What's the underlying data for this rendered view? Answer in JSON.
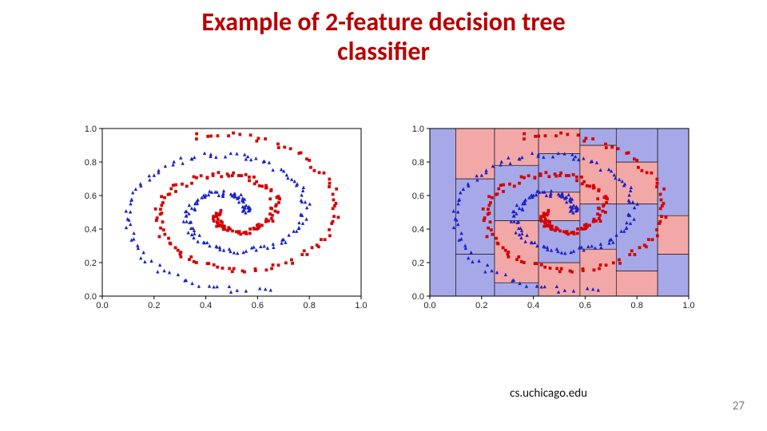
{
  "title_line1": "Example of 2-feature decision tree",
  "title_line2": "classifier",
  "attribution": "cs.uchicago.edu",
  "page_number": "27",
  "chart_data": [
    {
      "type": "scatter",
      "title": "",
      "xlabel": "",
      "ylabel": "",
      "xlim": [
        0.0,
        1.0
      ],
      "ylim": [
        0.0,
        1.0
      ],
      "xticks": [
        0.0,
        0.2,
        0.4,
        0.6,
        0.8,
        1.0
      ],
      "yticks": [
        0.0,
        0.2,
        0.4,
        0.6,
        0.8,
        1.0
      ],
      "series": [
        {
          "name": "class-blue",
          "color": "#1822c7",
          "marker": "triangle"
        },
        {
          "name": "class-red",
          "color": "#d40202",
          "marker": "square"
        }
      ],
      "note": "two interleaved spiral arms of ~200 points each spanning the full [0,1]×[0,1] square"
    },
    {
      "type": "scatter",
      "title": "",
      "xlabel": "",
      "ylabel": "",
      "xlim": [
        0.0,
        1.0
      ],
      "ylim": [
        0.0,
        1.0
      ],
      "xticks": [
        0.0,
        0.2,
        0.4,
        0.6,
        0.8,
        1.0
      ],
      "yticks": [
        0.0,
        0.2,
        0.4,
        0.6,
        0.8,
        1.0
      ],
      "series": [
        {
          "name": "class-blue",
          "color": "#1822c7",
          "marker": "triangle"
        },
        {
          "name": "class-red",
          "color": "#d40202",
          "marker": "square"
        }
      ],
      "background_regions": [
        {
          "x0": 0.0,
          "x1": 0.1,
          "y0": 0.0,
          "y1": 1.0,
          "class": "blue"
        },
        {
          "x0": 0.1,
          "x1": 0.25,
          "y0": 0.0,
          "y1": 0.25,
          "class": "blue"
        },
        {
          "x0": 0.1,
          "x1": 0.25,
          "y0": 0.25,
          "y1": 0.7,
          "class": "blue"
        },
        {
          "x0": 0.1,
          "x1": 0.25,
          "y0": 0.7,
          "y1": 1.0,
          "class": "red"
        },
        {
          "x0": 0.25,
          "x1": 0.42,
          "y0": 0.0,
          "y1": 0.08,
          "class": "blue"
        },
        {
          "x0": 0.25,
          "x1": 0.42,
          "y0": 0.08,
          "y1": 0.45,
          "class": "red"
        },
        {
          "x0": 0.25,
          "x1": 0.42,
          "y0": 0.45,
          "y1": 0.78,
          "class": "blue"
        },
        {
          "x0": 0.25,
          "x1": 0.42,
          "y0": 0.78,
          "y1": 1.0,
          "class": "red"
        },
        {
          "x0": 0.42,
          "x1": 0.58,
          "y0": 0.0,
          "y1": 0.2,
          "class": "red"
        },
        {
          "x0": 0.42,
          "x1": 0.58,
          "y0": 0.2,
          "y1": 0.45,
          "class": "blue"
        },
        {
          "x0": 0.42,
          "x1": 0.58,
          "y0": 0.45,
          "y1": 0.62,
          "class": "red"
        },
        {
          "x0": 0.42,
          "x1": 0.58,
          "y0": 0.62,
          "y1": 0.85,
          "class": "blue"
        },
        {
          "x0": 0.42,
          "x1": 0.58,
          "y0": 0.85,
          "y1": 1.0,
          "class": "red"
        },
        {
          "x0": 0.58,
          "x1": 0.72,
          "y0": 0.0,
          "y1": 0.28,
          "class": "red"
        },
        {
          "x0": 0.58,
          "x1": 0.72,
          "y0": 0.28,
          "y1": 0.55,
          "class": "blue"
        },
        {
          "x0": 0.58,
          "x1": 0.72,
          "y0": 0.55,
          "y1": 0.9,
          "class": "red"
        },
        {
          "x0": 0.58,
          "x1": 0.72,
          "y0": 0.9,
          "y1": 1.0,
          "class": "blue"
        },
        {
          "x0": 0.72,
          "x1": 0.88,
          "y0": 0.0,
          "y1": 0.15,
          "class": "red"
        },
        {
          "x0": 0.72,
          "x1": 0.88,
          "y0": 0.15,
          "y1": 0.55,
          "class": "blue"
        },
        {
          "x0": 0.72,
          "x1": 0.88,
          "y0": 0.55,
          "y1": 0.8,
          "class": "red"
        },
        {
          "x0": 0.72,
          "x1": 0.88,
          "y0": 0.8,
          "y1": 1.0,
          "class": "blue"
        },
        {
          "x0": 0.88,
          "x1": 1.0,
          "y0": 0.0,
          "y1": 0.25,
          "class": "blue"
        },
        {
          "x0": 0.88,
          "x1": 1.0,
          "y0": 0.25,
          "y1": 0.48,
          "class": "red"
        },
        {
          "x0": 0.88,
          "x1": 1.0,
          "y0": 0.48,
          "y1": 1.0,
          "class": "blue"
        }
      ],
      "note": "same spiral points as left plot overlaid on axis-aligned decision-tree regions"
    }
  ],
  "colors": {
    "region_blue": "#a7a8e8",
    "region_red": "#f3a8a8"
  }
}
